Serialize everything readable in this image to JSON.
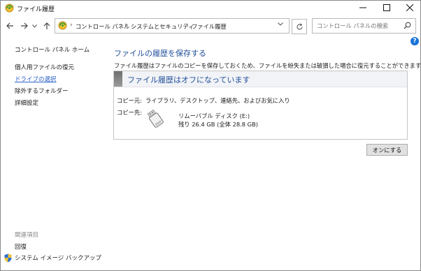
{
  "window": {
    "title": "ファイル履歴",
    "controls": [
      "minimize-icon",
      "maximize-icon",
      "close-icon"
    ]
  },
  "nav": {
    "back_icon": "back-arrow-icon",
    "forward_icon": "forward-arrow-icon",
    "recent_icon": "chevron-down-icon",
    "up_icon": "up-arrow-icon",
    "breadcrumb": [
      "コントロール パネル",
      "システムとセキュリティ",
      "ファイル履歴"
    ],
    "refresh_icon": "refresh-icon",
    "search_placeholder": "コントロール パネルの検索"
  },
  "sidebar": {
    "home": "コントロール パネル ホーム",
    "items": [
      "個人用ファイルの復元",
      "ドライブの選択",
      "除外するフォルダー",
      "詳細設定"
    ],
    "active_index": 1,
    "related_heading": "関連項目",
    "related": [
      "回復",
      "システム イメージ バックアップ"
    ]
  },
  "main": {
    "heading": "ファイルの履歴を保存する",
    "description": "ファイル履歴はファイルのコピーを保存しておくため、ファイルを紛失または破損した場合に復元することができます。",
    "status_title": "ファイル履歴はオフになっています",
    "copy_from_label": "コピー元:",
    "copy_from_value": "ライブラリ、デスクトップ、連絡先、およびお気に入り",
    "copy_to_label": "コピー先:",
    "drive_name": "リムーバブル ディスク (E:)",
    "drive_space": "残り 26.4 GB (全体 28.8 GB)",
    "turn_on_button": "オンにする"
  },
  "colors": {
    "accent_blue": "#1f4e99",
    "link_blue": "#2d63c8",
    "help_blue": "#1a73d8"
  }
}
